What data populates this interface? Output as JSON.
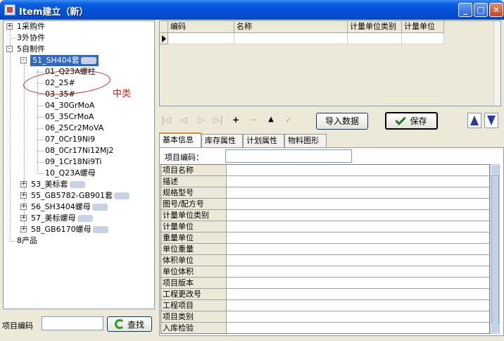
{
  "window": {
    "title": "Item建立（新）"
  },
  "tree": {
    "items": [
      {
        "label": "1采购件",
        "level": 0,
        "expander": "+"
      },
      {
        "label": "3外协件",
        "level": 0,
        "expander": ""
      },
      {
        "label": "5自制件",
        "level": 0,
        "expander": "-"
      },
      {
        "label": "51_SH404套",
        "level": 1,
        "expander": "-",
        "selected": true
      },
      {
        "label": "01_Q23A螺柱",
        "level": 2
      },
      {
        "label": "02_25#",
        "level": 2
      },
      {
        "label": "03_35#",
        "level": 2
      },
      {
        "label": "04_30GrMoA",
        "level": 2
      },
      {
        "label": "05_35CrMoA",
        "level": 2
      },
      {
        "label": "06_25Cr2MoVA",
        "level": 2
      },
      {
        "label": "07_0Cr19Ni9",
        "level": 2
      },
      {
        "label": "08_0Cr17Ni12Mj2",
        "level": 2
      },
      {
        "label": "09_1Cr18Ni9Ti",
        "level": 2
      },
      {
        "label": "10_Q23A螺母",
        "level": 2
      },
      {
        "label": "53_美标套",
        "level": 1,
        "expander": "+"
      },
      {
        "label": "55_GB5782-GB901套",
        "level": 1,
        "expander": "+"
      },
      {
        "label": "56_SH3404螺母",
        "level": 1,
        "expander": "+"
      },
      {
        "label": "57_美标螺母",
        "level": 1,
        "expander": "+"
      },
      {
        "label": "58_GB6170螺母",
        "level": 1,
        "expander": "+"
      },
      {
        "label": "8产品",
        "level": 0,
        "expander": ""
      }
    ],
    "annotation": "中类"
  },
  "search": {
    "label": "项目编码",
    "value": "",
    "button_label": "查找"
  },
  "grid": {
    "columns": [
      "编码",
      "名称",
      "计量单位类别",
      "计量单位"
    ]
  },
  "toolbar": {
    "nav_icons": [
      "first-icon",
      "prev-icon",
      "next-icon",
      "last-icon",
      "add-icon",
      "delete-icon",
      "move-up-icon",
      "confirm-icon"
    ],
    "import_label": "导入数据",
    "save_label": "保存"
  },
  "tabs": [
    "基本信息",
    "库存属性",
    "计划属性",
    "物料图形"
  ],
  "form": {
    "item_code_label": "项目编码：",
    "properties": [
      "项目名称",
      "描述",
      "规格型号",
      "图号/配方号",
      "计量单位类别",
      "计量单位",
      "重量单位",
      "单位重量",
      "体积单位",
      "单位体积",
      "项目版本",
      "工程更改号",
      "工程项目",
      "项目类别",
      "入库检验"
    ]
  }
}
